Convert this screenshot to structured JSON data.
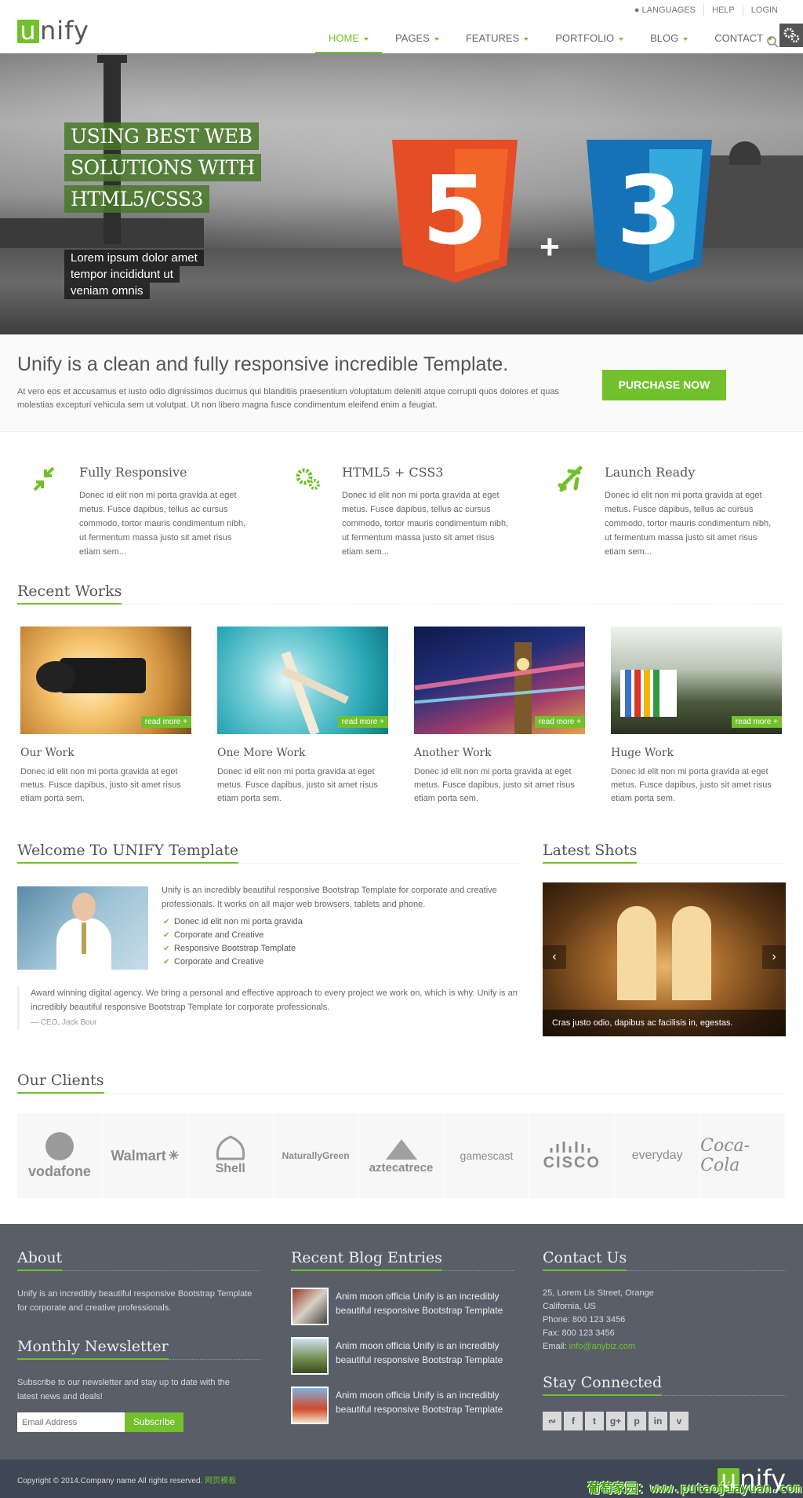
{
  "header": {
    "logo_letter": "u",
    "logo_rest": "nify",
    "top_links": [
      "LANGUAGES",
      "HELP",
      "LOGIN"
    ],
    "nav": [
      "HOME",
      "PAGES",
      "FEATURES",
      "PORTFOLIO",
      "BLOG",
      "CONTACT"
    ],
    "active_nav": "HOME"
  },
  "hero": {
    "title_lines": [
      "USING BEST WEB",
      "SOLUTIONS WITH",
      "HTML5/CSS3"
    ],
    "subtitle_lines": [
      "Lorem ipsum dolor amet",
      "tempor incididunt ut",
      "veniam omnis"
    ],
    "html5_badge": "5",
    "css3_badge": "3",
    "plus": "+",
    "slide_count": 3,
    "active_slide": 3,
    "colors": {
      "html5": "#e44d26",
      "css3": "#1572b6"
    }
  },
  "purchase": {
    "heading": "Unify is a clean and fully responsive incredible Template.",
    "text": "At vero eos et accusamus et iusto odio dignissimos ducimus qui blanditiis praesentium voluptatum deleniti atque corrupti quos dolores et quas molestias excepturi vehicula sem ut volutpat. Ut non libero magna fusce condimentum eleifend enim a feugiat.",
    "button": "PURCHASE NOW"
  },
  "services": [
    {
      "icon": "resize-icon",
      "title": "Fully Responsive",
      "text": "Donec id elit non mi porta gravida at eget metus. Fusce dapibus, tellus ac cursus commodo, tortor mauris condimentum nibh, ut fermentum massa justo sit amet risus etiam sem..."
    },
    {
      "icon": "gears-icon",
      "title": "HTML5 + CSS3",
      "text": "Donec id elit non mi porta gravida at eget metus. Fusce dapibus, tellus ac cursus commodo, tortor mauris condimentum nibh, ut fermentum massa justo sit amet risus etiam sem..."
    },
    {
      "icon": "plane-icon",
      "title": "Launch Ready",
      "text": "Donec id elit non mi porta gravida at eget metus. Fusce dapibus, tellus ac cursus commodo, tortor mauris condimentum nibh, ut fermentum massa justo sit amet risus etiam sem..."
    }
  ],
  "recent_works": {
    "heading": "Recent Works",
    "read_more": "read more +",
    "items": [
      {
        "title": "Our Work",
        "text": "Donec id elit non mi porta gravida at eget metus. Fusce dapibus, justo sit amet risus etiam porta sem."
      },
      {
        "title": "One More Work",
        "text": "Donec id elit non mi porta gravida at eget metus. Fusce dapibus, justo sit amet risus etiam porta sem."
      },
      {
        "title": "Another Work",
        "text": "Donec id elit non mi porta gravida at eget metus. Fusce dapibus, justo sit amet risus etiam porta sem."
      },
      {
        "title": "Huge Work",
        "text": "Donec id elit non mi porta gravida at eget metus. Fusce dapibus, justo sit amet risus etiam porta sem."
      }
    ]
  },
  "welcome": {
    "heading": "Welcome To UNIFY Template",
    "intro": "Unify is an incredibly beautiful responsive Bootstrap Template for corporate and creative professionals. It works on all major web browsers, tablets and phone.",
    "checks": [
      "Donec id elit non mi porta gravida",
      "Corporate and Creative",
      "Responsive Bootstrap Template",
      "Corporate and Creative"
    ],
    "quote": "Award winning digital agency. We bring a personal and effective approach to every project we work on, which is why. Unify is an incredibly beautiful responsive Bootstrap Template for corporate professionals.",
    "quote_author": "— CEO, Jack Bour"
  },
  "latest_shots": {
    "heading": "Latest Shots",
    "caption": "Cras justo odio, dapibus ac facilisis in, egestas."
  },
  "clients": {
    "heading": "Our Clients",
    "logos": [
      "vodafone",
      "Walmart",
      "Shell",
      "NaturallyGreen",
      "aztecatrece",
      "gamescast",
      "CISCO",
      "everyday",
      "Coca-Cola"
    ]
  },
  "footer": {
    "about_heading": "About",
    "about_text": "Unify is an incredibly beautiful responsive Bootstrap Template for corporate and creative professionals.",
    "newsletter_heading": "Monthly Newsletter",
    "newsletter_text": "Subscribe to our newsletter and stay up to date with the latest news and deals!",
    "newsletter_placeholder": "Email Address",
    "subscribe": "Subscribe",
    "blog_heading": "Recent Blog Entries",
    "blog_items": [
      "Anim moon officia Unify is an incredibly beautiful responsive Bootstrap Template",
      "Anim moon officia Unify is an incredibly beautiful responsive Bootstrap Template",
      "Anim moon officia Unify is an incredibly beautiful responsive Bootstrap Template"
    ],
    "contact_heading": "Contact Us",
    "address1": "25, Lorem Lis Street, Orange",
    "address2": "California, US",
    "phone": "Phone: 800 123 3456",
    "fax": "Fax: 800 123 3456",
    "email_label": "Email: ",
    "email": "info@anybiz.com",
    "stay_heading": "Stay Connected",
    "social": [
      "rss-icon",
      "facebook-icon",
      "twitter-icon",
      "googleplus-icon",
      "pinterest-icon",
      "linkedin-icon",
      "vimeo-icon"
    ]
  },
  "copyright": {
    "text": "Copyright © 2014.Company name All rights reserved. ",
    "link": "网页模板",
    "logo_letter": "u",
    "logo_rest": "nify",
    "watermark": "葡萄家园：www.putaojiayuan.com"
  },
  "accent_color": "#72c02c"
}
